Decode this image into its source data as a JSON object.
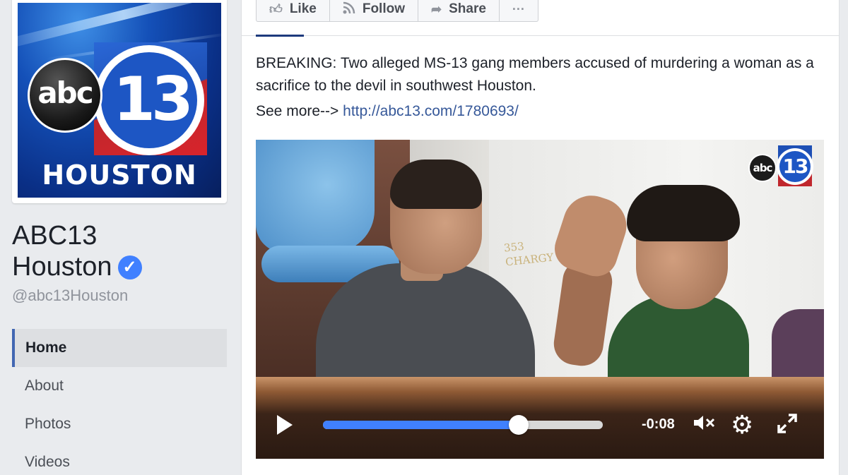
{
  "page": {
    "name": "ABC13 Houston",
    "handle": "@abc13Houston",
    "logo": {
      "abc_text": "abc",
      "number": "13",
      "city": "HOUSTON"
    }
  },
  "nav": {
    "items": [
      {
        "label": "Home",
        "active": true
      },
      {
        "label": "About",
        "active": false
      },
      {
        "label": "Photos",
        "active": false
      },
      {
        "label": "Videos",
        "active": false
      }
    ]
  },
  "actions": {
    "like": "Like",
    "follow": "Follow",
    "share": "Share",
    "more": "···"
  },
  "post": {
    "text": "BREAKING: Two alleged MS-13 gang members accused of murdering a woman as a sacrifice to the devil in southwest Houston.",
    "see_more_prefix": "See more--> ",
    "link": "http://abc13.com/1780693/"
  },
  "video": {
    "scribble_line1": "353",
    "scribble_line2": "CHARGY",
    "watermark_abc": "abc",
    "watermark_number": "13",
    "time_remaining": "-0:08",
    "progress_fraction": 0.7
  },
  "colors": {
    "accent": "#4267b2",
    "link": "#365899",
    "progress": "#4080ff",
    "verified": "#4080ff"
  },
  "icons": {
    "like": "thumbs-up-icon",
    "follow": "rss-icon",
    "share": "share-arrow-icon",
    "more": "ellipsis-icon",
    "play": "play-icon",
    "mute": "mute-icon",
    "settings": "gear-icon",
    "fullscreen": "fullscreen-icon"
  }
}
